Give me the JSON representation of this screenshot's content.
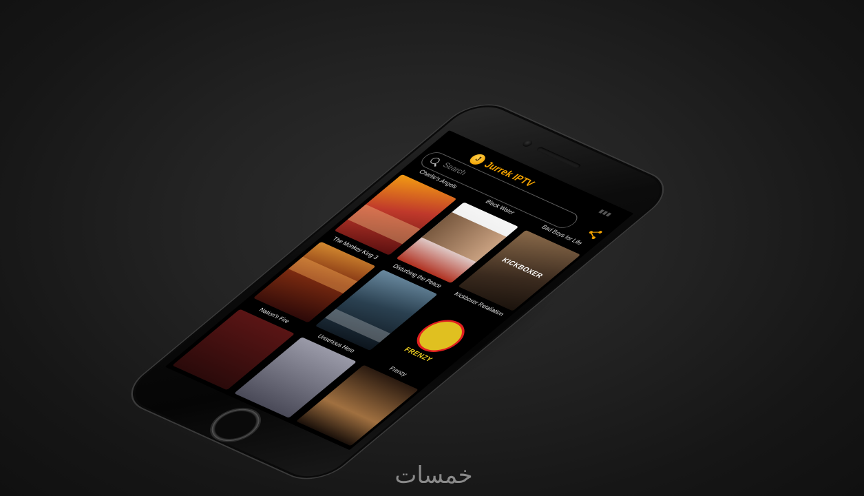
{
  "app": {
    "title": "Jurrek IPTV",
    "logo_glyph": "J",
    "accent_color": "#f4a300"
  },
  "search": {
    "placeholder": "Search"
  },
  "partial_row_top": [
    "Charlie's Angels",
    "Black Water",
    "Bad Boys for Life"
  ],
  "posters": [
    {
      "title": "The Monkey King 3",
      "colors": [
        "#c0392b",
        "#f39c12"
      ],
      "text": ""
    },
    {
      "title": "Disturbing the Peace",
      "colors": [
        "#f5f5f5",
        "#b03020"
      ],
      "text": ""
    },
    {
      "title": "Kickboxer Retaliation",
      "colors": [
        "#3a2a1e",
        "#8a6a4a"
      ],
      "text": "KICKBOXER"
    },
    {
      "title": "Nation's Fire",
      "colors": [
        "#4a1010",
        "#d48a30"
      ],
      "text": ""
    },
    {
      "title": "Unserious Hero",
      "colors": [
        "#12202e",
        "#6a8aa0"
      ],
      "text": ""
    },
    {
      "title": "Frenzy",
      "colors": [
        "#000000",
        "#e02020"
      ],
      "text": "FRENZY"
    }
  ],
  "watermark": {
    "text": "خمسات"
  }
}
